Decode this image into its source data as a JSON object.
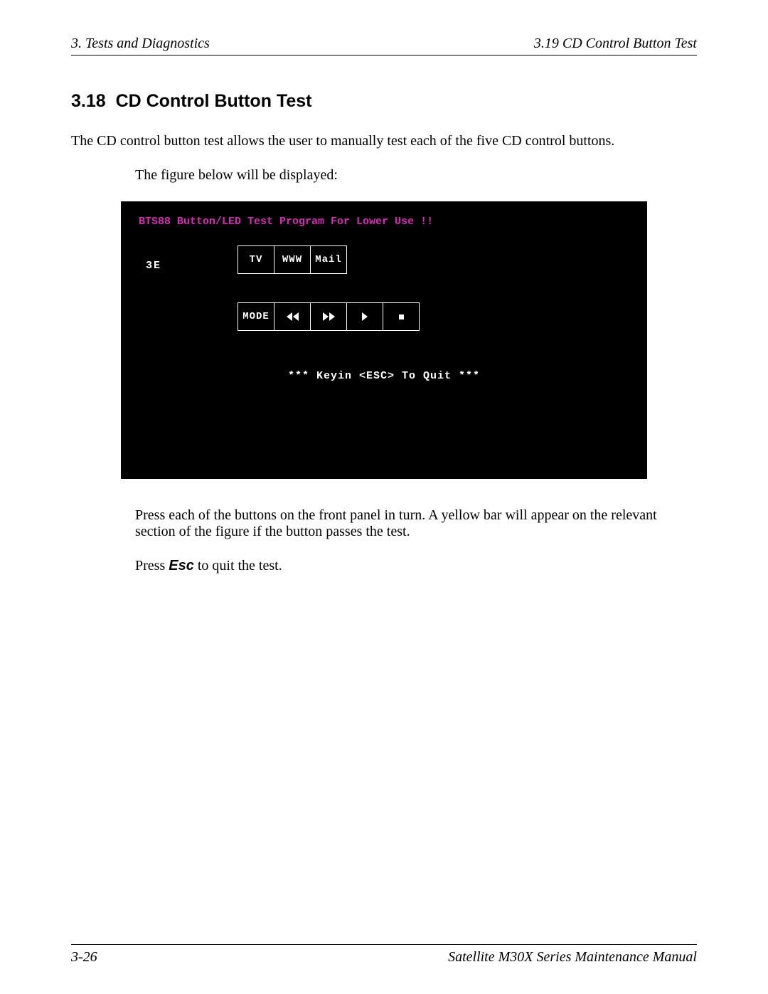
{
  "header": {
    "left": "3.  Tests and Diagnostics",
    "right": "3.19  CD Control Button Test"
  },
  "section": {
    "number": "3.18",
    "title": "CD Control Button Test"
  },
  "intro": "The CD control button test allows the user to manually test each of the five CD control buttons.",
  "figure_caption": "The figure below will be displayed:",
  "terminal": {
    "title": "BTS88 Button/LED Test Program For Lower Use !!",
    "code": "3E",
    "row1": [
      "TV",
      "WWW",
      "Mail"
    ],
    "row2_labels": [
      "MODE",
      "rewind",
      "fast-forward",
      "play",
      "stop"
    ],
    "mode_label": "MODE",
    "quit": "*** Keyin <ESC> To Quit ***"
  },
  "instructions": {
    "press_buttons": "Press each of the buttons on the front panel in turn. A yellow bar will appear on the relevant section of the figure if the button passes the test.",
    "press_prefix": "Press ",
    "esc_key": "Esc",
    "press_suffix": " to quit the test."
  },
  "footer": {
    "left": "3-26",
    "right": "Satellite M30X Series Maintenance Manual"
  }
}
